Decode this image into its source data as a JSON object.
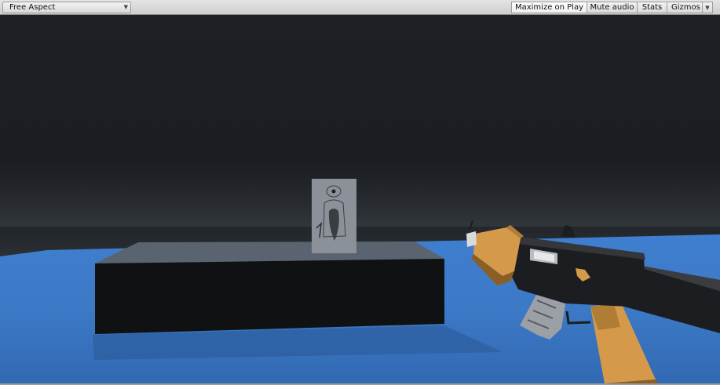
{
  "toolbar": {
    "aspect_label": "Free Aspect",
    "buttons": {
      "maximize": "Maximize on Play",
      "mute": "Mute audio",
      "stats": "Stats",
      "gizmos": "Gizmos"
    }
  },
  "scene": {
    "sky_color": "#1d2024",
    "water_color": "#3a78c8",
    "platform_color": "#0f1112",
    "target_color": "#8c9199",
    "gun_wood_color": "#d49a4a",
    "gun_metal_color": "#1c1d20"
  }
}
